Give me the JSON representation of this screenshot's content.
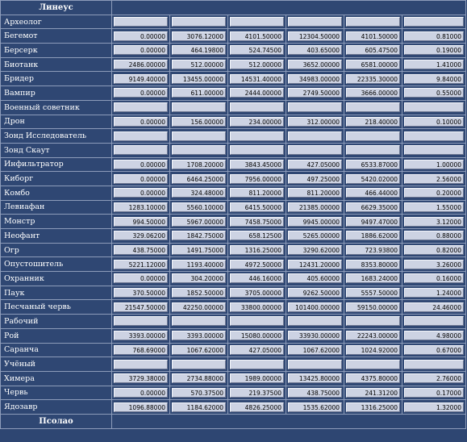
{
  "header": {
    "title": "Линеус",
    "footer": "Псолао"
  },
  "rows": [
    {
      "name": "Археолог",
      "values": [
        "",
        "",
        "",
        "",
        "",
        ""
      ]
    },
    {
      "name": "Бегемот",
      "values": [
        "0.00000",
        "3076.12000",
        "4101.50000",
        "12304.50000",
        "4101.50000",
        "0.81000"
      ]
    },
    {
      "name": "Берсерк",
      "values": [
        "0.00000",
        "464.19800",
        "524.74500",
        "403.65000",
        "605.47500",
        "0.19000"
      ]
    },
    {
      "name": "Биотанк",
      "values": [
        "2486.00000",
        "512.00000",
        "512.00000",
        "3652.00000",
        "6581.00000",
        "1.41000"
      ]
    },
    {
      "name": "Бридер",
      "values": [
        "9149.40000",
        "13455.00000",
        "14531.40000",
        "34983.00000",
        "22335.30000",
        "9.84000"
      ]
    },
    {
      "name": "Вампир",
      "values": [
        "0.00000",
        "611.00000",
        "2444.00000",
        "2749.50000",
        "3666.00000",
        "0.55000"
      ]
    },
    {
      "name": "Военный советник",
      "values": [
        "",
        "",
        "",
        "",
        "",
        ""
      ]
    },
    {
      "name": "Дрон",
      "values": [
        "0.00000",
        "156.00000",
        "234.00000",
        "312.00000",
        "218.40000",
        "0.10000"
      ]
    },
    {
      "name": "Зонд Исследователь",
      "values": [
        "",
        "",
        "",
        "",
        "",
        ""
      ]
    },
    {
      "name": "Зонд Скаут",
      "values": [
        "",
        "",
        "",
        "",
        "",
        ""
      ]
    },
    {
      "name": "Инфильтратор",
      "values": [
        "0.00000",
        "1708.20000",
        "3843.45000",
        "427.05000",
        "6533.87000",
        "1.00000"
      ]
    },
    {
      "name": "Киборг",
      "values": [
        "0.00000",
        "6464.25000",
        "7956.00000",
        "497.25000",
        "5420.02000",
        "2.56000"
      ]
    },
    {
      "name": "Комбо",
      "values": [
        "0.00000",
        "324.48000",
        "811.20000",
        "811.20000",
        "466.44000",
        "0.20000"
      ]
    },
    {
      "name": "Левиафан",
      "values": [
        "1283.10000",
        "5560.10000",
        "6415.50000",
        "21385.00000",
        "6629.35000",
        "1.55000"
      ]
    },
    {
      "name": "Монстр",
      "values": [
        "994.50000",
        "5967.00000",
        "7458.75000",
        "9945.00000",
        "9497.47000",
        "3.12000"
      ]
    },
    {
      "name": "Неофант",
      "values": [
        "329.06200",
        "1842.75000",
        "658.12500",
        "5265.00000",
        "1886.62000",
        "0.88000"
      ]
    },
    {
      "name": "Огр",
      "values": [
        "438.75000",
        "1491.75000",
        "1316.25000",
        "3290.62000",
        "723.93800",
        "0.82000"
      ]
    },
    {
      "name": "Опустошитель",
      "values": [
        "5221.12000",
        "1193.40000",
        "4972.50000",
        "12431.20000",
        "8353.80000",
        "3.26000"
      ]
    },
    {
      "name": "Охранник",
      "values": [
        "0.00000",
        "304.20000",
        "446.16000",
        "405.60000",
        "1683.24000",
        "0.16000"
      ]
    },
    {
      "name": "Паук",
      "values": [
        "370.50000",
        "1852.50000",
        "3705.00000",
        "9262.50000",
        "5557.50000",
        "1.24000"
      ]
    },
    {
      "name": "Песчаный червь",
      "values": [
        "21547.50000",
        "42250.00000",
        "33800.00000",
        "101400.00000",
        "59150.00000",
        "24.46000"
      ]
    },
    {
      "name": "Рабочий",
      "values": [
        "",
        "",
        "",
        "",
        "",
        ""
      ]
    },
    {
      "name": "Рой",
      "values": [
        "3393.00000",
        "3393.00000",
        "15080.00000",
        "33930.00000",
        "22243.00000",
        "4.98000"
      ]
    },
    {
      "name": "Саранча",
      "values": [
        "768.69000",
        "1067.62000",
        "427.05000",
        "1067.62000",
        "1024.92000",
        "0.67000"
      ]
    },
    {
      "name": "Учёный",
      "values": [
        "",
        "",
        "",
        "",
        "",
        ""
      ]
    },
    {
      "name": "Химера",
      "values": [
        "3729.38000",
        "2734.88000",
        "1989.00000",
        "13425.80000",
        "4375.80000",
        "2.76000"
      ]
    },
    {
      "name": "Червь",
      "values": [
        "0.00000",
        "570.37500",
        "219.37500",
        "438.75000",
        "241.31200",
        "0.17000"
      ]
    },
    {
      "name": "Ядозавр",
      "values": [
        "1096.88000",
        "1184.62000",
        "4826.25000",
        "1535.62000",
        "1316.25000",
        "1.32000"
      ]
    }
  ]
}
